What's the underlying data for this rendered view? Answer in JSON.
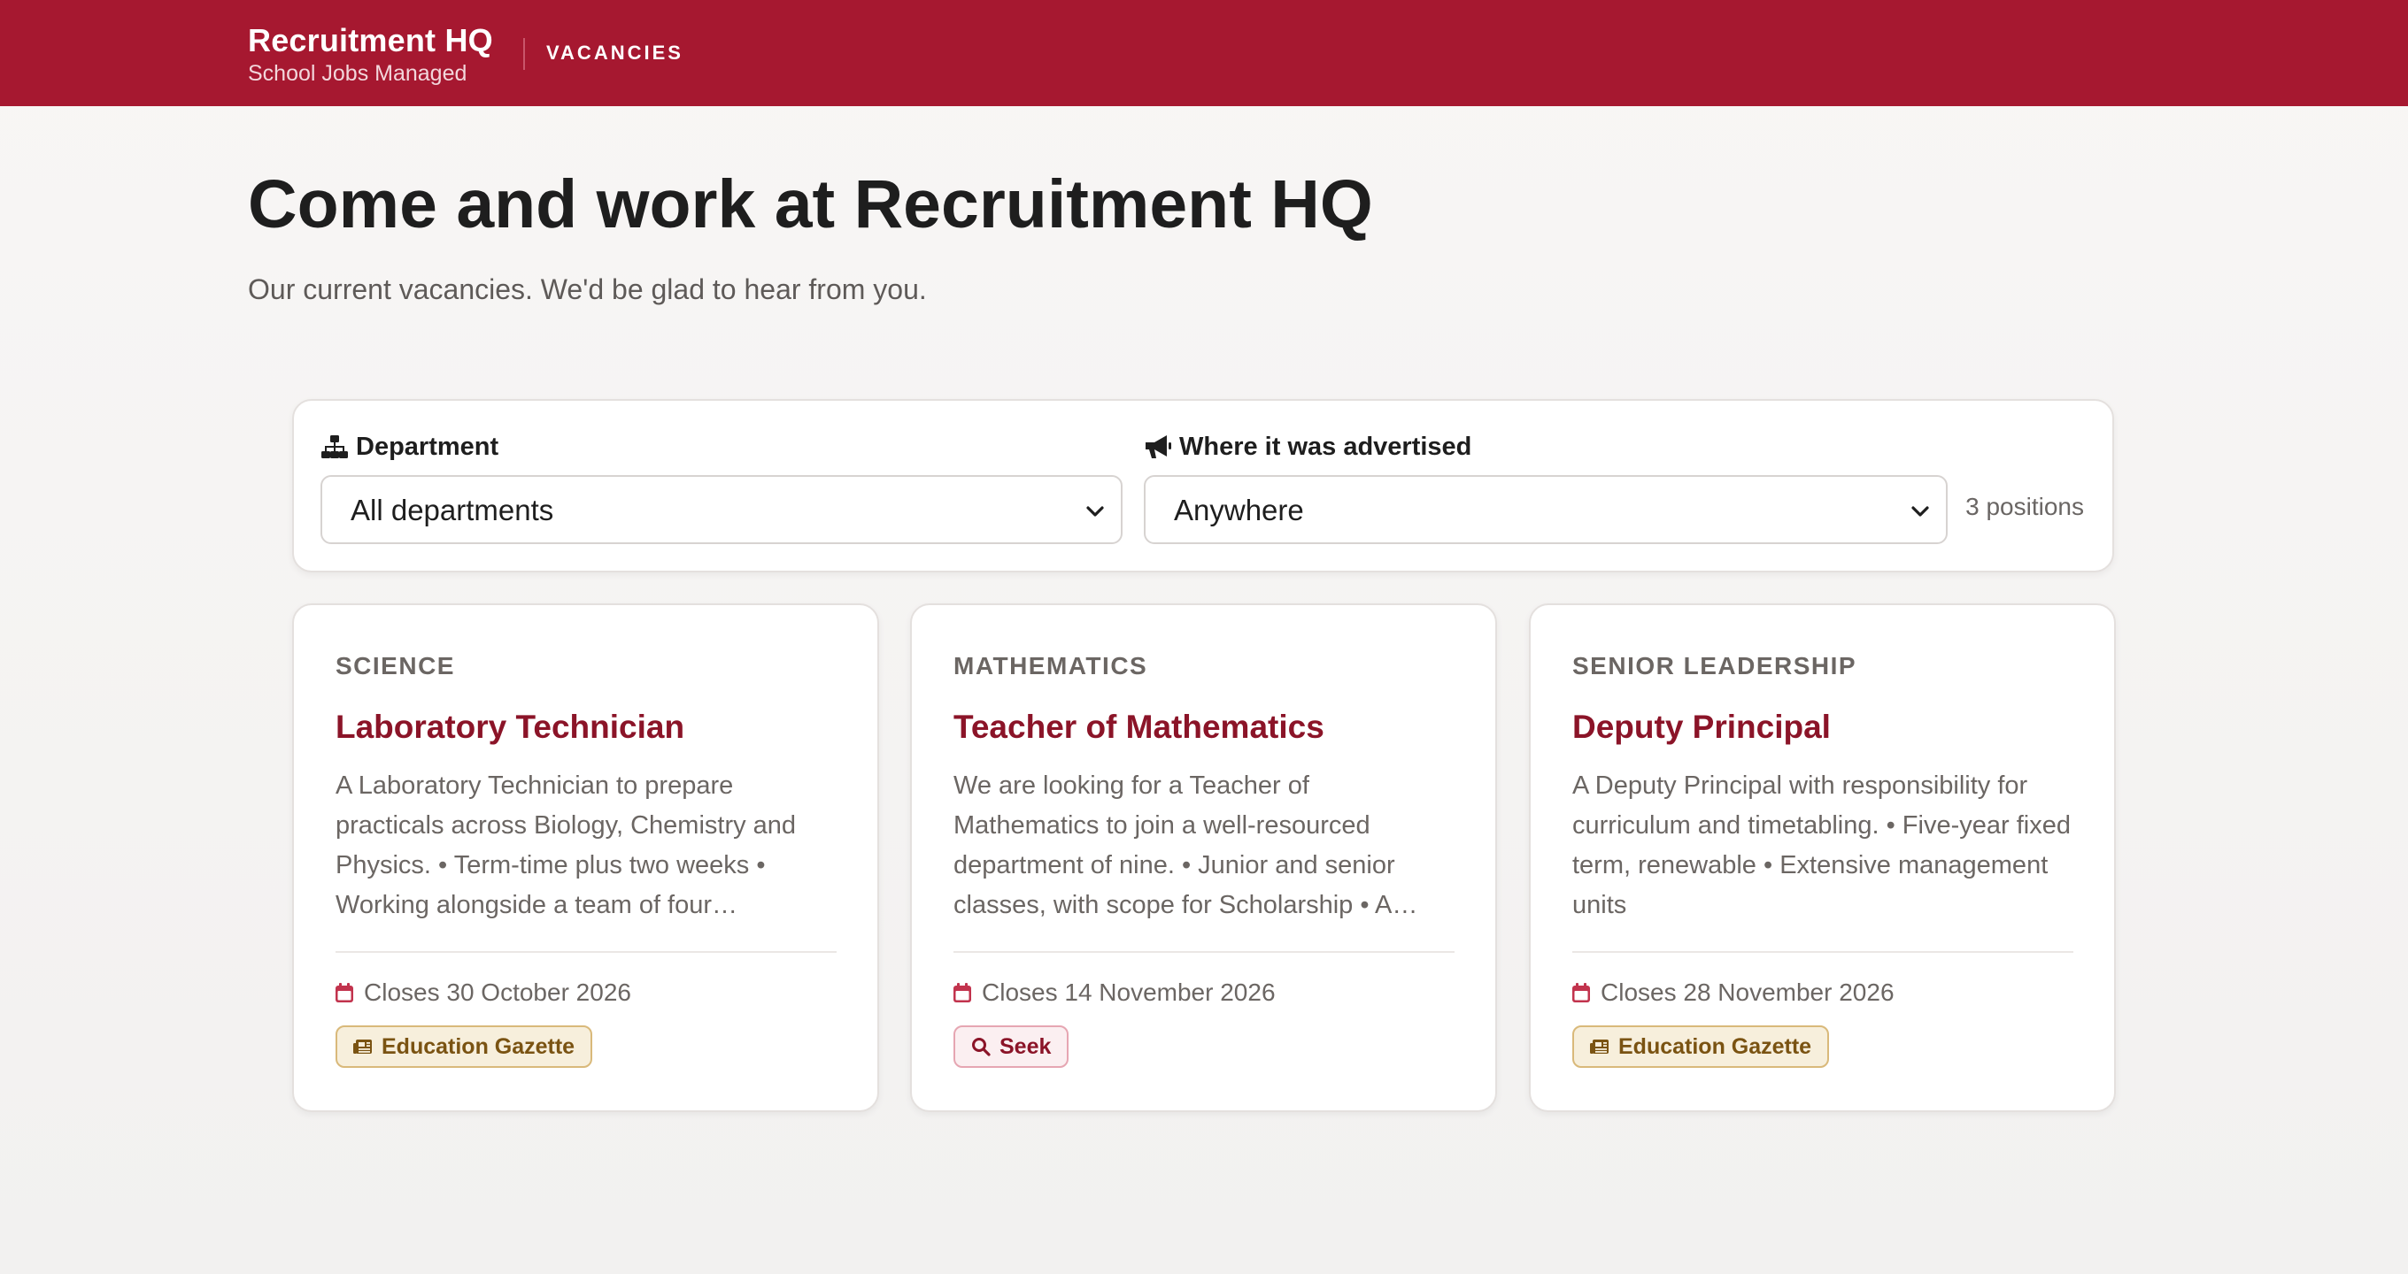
{
  "header": {
    "brand_name": "Recruitment HQ",
    "brand_tagline": "School Jobs Managed",
    "nav": [
      {
        "label": "VACANCIES"
      }
    ],
    "color": "#a61830"
  },
  "hero": {
    "title": "Come and work at Recruitment HQ",
    "subtitle": "Our current vacancies. We'd be glad to hear from you."
  },
  "filters": {
    "department": {
      "label": "Department",
      "icon": "sitemap-icon",
      "selected": "All departments"
    },
    "advertised": {
      "label": "Where it was advertised",
      "icon": "megaphone-icon",
      "selected": "Anywhere"
    },
    "count_text": "3 positions"
  },
  "vacancies": [
    {
      "department": "SCIENCE",
      "title": "Laboratory Technician",
      "description": "A Laboratory Technician to prepare practicals across Biology, Chemistry and Physics. • Term-time plus two weeks • Working alongside a team of four…",
      "closes": "Closes 30 October 2026",
      "source": "Education Gazette",
      "source_icon": "newspaper-icon"
    },
    {
      "department": "MATHEMATICS",
      "title": "Teacher of Mathematics",
      "description": "We are looking for a Teacher of Mathematics to join a well-resourced department of nine. • Junior and senior classes, with scope for Scholarship • A…",
      "closes": "Closes 14 November 2026",
      "source": "Seek",
      "source_icon": "search-icon"
    },
    {
      "department": "SENIOR LEADERSHIP",
      "title": "Deputy Principal",
      "description": "A Deputy Principal with responsibility for curriculum and timetabling. • Five-year fixed term, renewable • Extensive management units",
      "closes": "Closes 28 November 2026",
      "source": "Education Gazette",
      "source_icon": "newspaper-icon"
    }
  ]
}
